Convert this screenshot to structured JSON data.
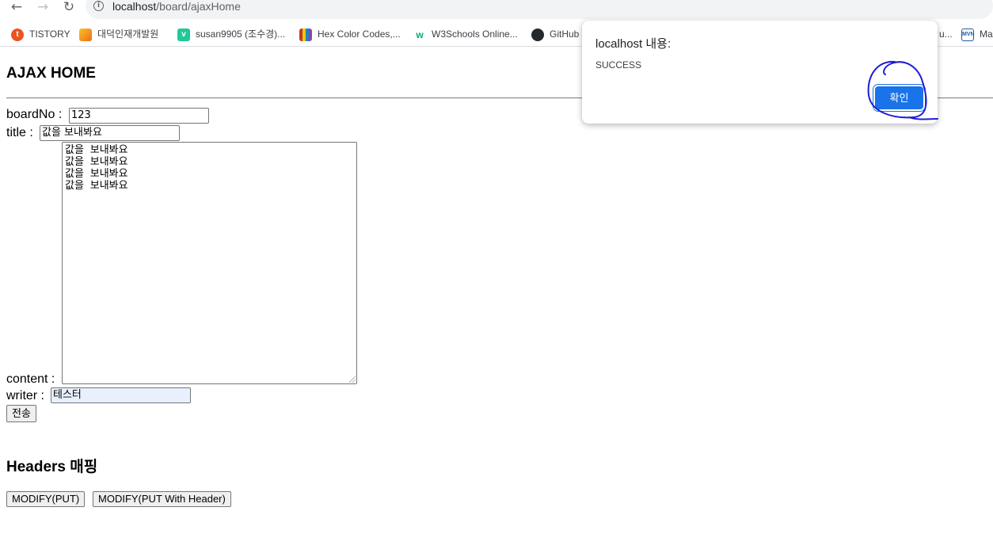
{
  "browser": {
    "url_host": "localhost",
    "url_path": "/board/ajaxHome",
    "bookmarks": [
      {
        "label": "TISTORY",
        "icon": "tistory-icon",
        "color": "#eb531f"
      },
      {
        "label": "대덕인재개발원",
        "icon": "ddit-icon",
        "color": "#f29b1c"
      },
      {
        "label": "susan9905 (조수경)...",
        "icon": "velog-icon",
        "color": "#20c997"
      },
      {
        "label": "Hex Color Codes,...",
        "icon": "book-icon",
        "color": "#c0392b"
      },
      {
        "label": "W3Schools Online...",
        "icon": "w3schools-icon",
        "color": "#04aa6d"
      },
      {
        "label": "GitHub",
        "icon": "github-icon",
        "color": "#24292e"
      },
      {
        "label": "u...",
        "icon": "bookmark-icon",
        "color": "#5f6368"
      },
      {
        "label": "Ma",
        "icon": "mvn-icon",
        "color": "#1f5aa6"
      }
    ]
  },
  "page": {
    "title": "AJAX HOME",
    "board_no_label": "boardNo :",
    "board_no_value": "123",
    "title_label": "title :",
    "title_value": "값을 보내봐요",
    "content_label": "content :",
    "content_value": "값을 보내봐요\n값을 보내봐요\n값을 보내봐요\n값을 보내봐요",
    "writer_label": "writer :",
    "writer_value": "테스터",
    "submit_label": "전송",
    "headers_title": "Headers 매핑",
    "modify_put_label": "MODIFY(PUT)",
    "modify_put_header_label": "MODIFY(PUT With Header)"
  },
  "dialog": {
    "title": "localhost 내용:",
    "message": "SUCCESS",
    "ok_label": "확인"
  },
  "colors": {
    "accent": "#1a73e8",
    "annotation": "#1d1dd6",
    "autofill": "#e8f0fe"
  }
}
